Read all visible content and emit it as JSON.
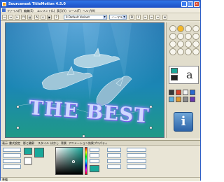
{
  "window": {
    "title": "Sourcenext TitleMotion 4.5.0"
  },
  "menubar": {
    "items": [
      "ファイル(F)",
      "編集(E)",
      "エレメント(L)",
      "表示(V)",
      "ツール(T)",
      "ヘルプ(H)"
    ]
  },
  "toolbar": {
    "font_select": "0 Default Variant",
    "style_select": "ノーマル"
  },
  "canvas": {
    "overlay_text": "THE BEST"
  },
  "sidepanel": {
    "letter_sample": "a"
  },
  "bottom": {
    "tabs": [
      "表示",
      "書式設定",
      "影と輪郭",
      "スタイル",
      "ぼかし",
      "背景",
      "アニメーション効果",
      "プロパティ"
    ]
  },
  "status": {
    "text": "準備"
  },
  "colors": {
    "title_bar": "#1f5cd6",
    "accent_teal": "#1aa89a",
    "sea_top": "#1a6ea8",
    "sea_bottom": "#1f9a86"
  }
}
